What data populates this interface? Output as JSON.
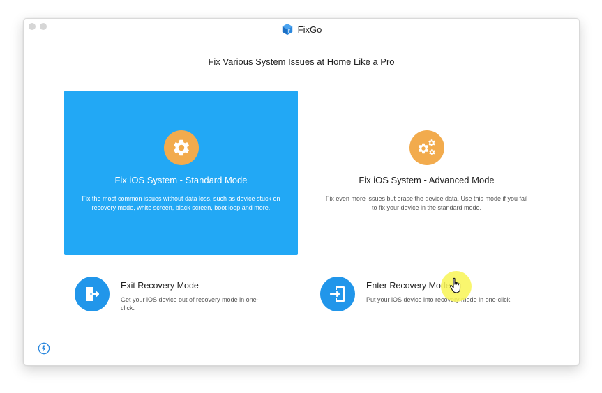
{
  "window": {
    "app_name": "FixGo",
    "app_icon": "fixgo-cube-logo-icon"
  },
  "main": {
    "headline": "Fix Various System Issues at Home Like a Pro",
    "modes": [
      {
        "title": "Fix iOS System - Standard Mode",
        "description": "Fix the most common issues without data loss, such as device stuck on recovery mode, white screen, black screen, boot loop and more.",
        "icon": "gear-icon",
        "selected": true
      },
      {
        "title": "Fix iOS System - Advanced Mode",
        "description": "Fix even more issues but erase the device data. Use this mode if you fail to fix your device in the standard mode.",
        "icon": "gears-icon",
        "selected": false
      }
    ],
    "tools": [
      {
        "title": "Exit Recovery Mode",
        "description": "Get your iOS device out of recovery mode in one-click.",
        "icon": "exit-door-icon"
      },
      {
        "title": "Enter Recovery Mode",
        "description": "Put your iOS device into recovery mode in one-click.",
        "icon": "enter-door-icon"
      }
    ]
  },
  "footer": {
    "icon": "feedback-icon"
  },
  "colors": {
    "accent_blue": "#22a8f5",
    "icon_orange": "#f2ab4d",
    "tool_blue": "#2196ea",
    "cursor_highlight": "#f8f55a"
  }
}
